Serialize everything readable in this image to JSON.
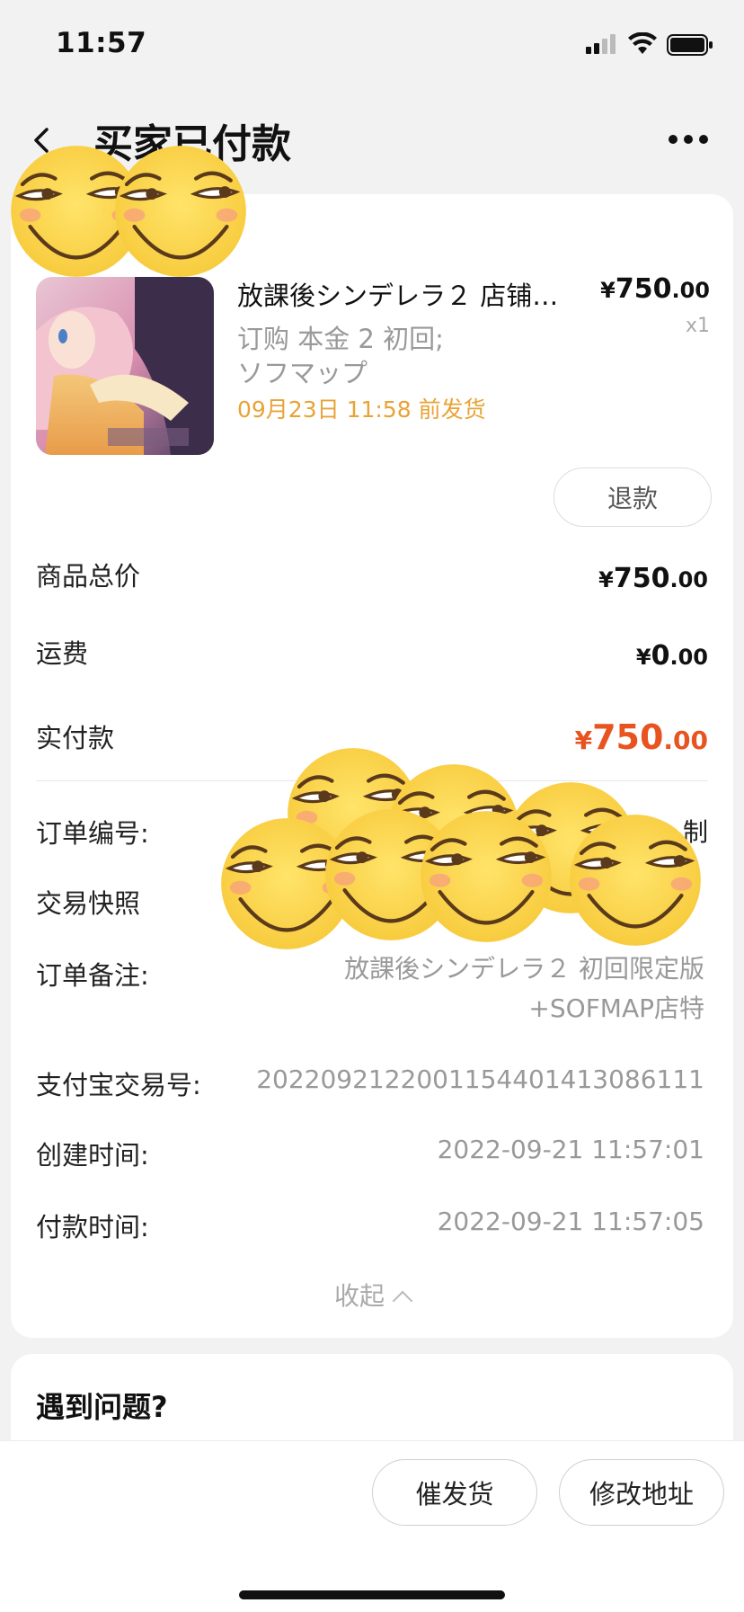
{
  "status_bar": {
    "time": "11:57"
  },
  "nav": {
    "title": "买家已付款",
    "back_icon": "chevron-left-icon",
    "more_icon": "more-dots-icon"
  },
  "product": {
    "name": "放課後シンデレラ２ 店铺…",
    "spec": "订购 本金 2 初回;\nソフマップ",
    "deadline": "09月23日 11:58 前发货",
    "price_symbol": "¥",
    "price_int": "750",
    "price_dec": ".00",
    "quantity": "x1",
    "refund_label": "退款"
  },
  "summary": {
    "goods_total": {
      "label": "商品总价",
      "symbol": "¥",
      "int": "750",
      "dec": ".00"
    },
    "shipping": {
      "label": "运费",
      "symbol": "¥",
      "int": "0",
      "dec": ".00"
    },
    "paid": {
      "label": "实付款",
      "symbol": "¥",
      "int": "750",
      "dec": ".00",
      "color": "#e8541f"
    }
  },
  "details": {
    "order_no": {
      "label": "订单编号:",
      "action": "制"
    },
    "snapshot": {
      "label": "交易快照"
    },
    "remark": {
      "label": "订单备注:",
      "value": "放課後シンデレラ２ 初回限定版\n+SOFMAP店特"
    },
    "alipay_no": {
      "label": "支付宝交易号:",
      "value": "2022092122001154401413086111"
    },
    "created": {
      "label": "创建时间:",
      "value": "2022-09-21 11:57:01"
    },
    "paid_time": {
      "label": "付款时间:",
      "value": "2022-09-21 11:57:05"
    },
    "collapse_label": "收起"
  },
  "problem_section": {
    "title": "遇到问题?"
  },
  "bottom_bar": {
    "urge_label": "催发货",
    "change_address_label": "修改地址"
  },
  "colors": {
    "accent": "#e8541f",
    "deadline": "#e8a336",
    "background": "#f2f2f2"
  }
}
